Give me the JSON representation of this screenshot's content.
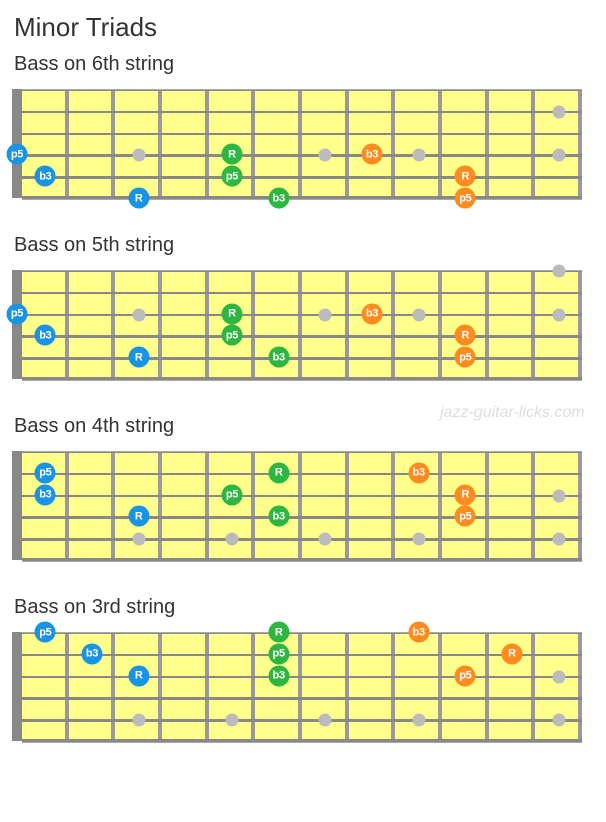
{
  "title": "Minor Triads",
  "watermark": "jazz-guitar-licks.com",
  "fret_count": 12,
  "string_count": 6,
  "fret_markers_single": [
    3,
    5,
    7,
    9
  ],
  "fret_markers_double": [
    12
  ],
  "colors": {
    "blue": "#1893E6",
    "green": "#2DB742",
    "orange": "#FF8A1E"
  },
  "diagrams": [
    {
      "subtitle": "Bass   on 6th string",
      "marker_string": 4,
      "notes": [
        {
          "fret": 0,
          "string": 4,
          "label": "p5",
          "color": "blue"
        },
        {
          "fret": 1,
          "string": 5,
          "label": "b3",
          "color": "blue"
        },
        {
          "fret": 3,
          "string": 6,
          "label": "R",
          "color": "blue"
        },
        {
          "fret": 5,
          "string": 4,
          "label": "R",
          "color": "green"
        },
        {
          "fret": 5,
          "string": 5,
          "label": "p5",
          "color": "green"
        },
        {
          "fret": 6,
          "string": 6,
          "label": "b3",
          "color": "green"
        },
        {
          "fret": 8,
          "string": 4,
          "label": "b3",
          "color": "orange"
        },
        {
          "fret": 10,
          "string": 5,
          "label": "R",
          "color": "orange"
        },
        {
          "fret": 10,
          "string": 6,
          "label": "p5",
          "color": "orange"
        }
      ]
    },
    {
      "subtitle": "Bass   on 5th string",
      "marker_string": 3,
      "notes": [
        {
          "fret": 0,
          "string": 3,
          "label": "p5",
          "color": "blue"
        },
        {
          "fret": 1,
          "string": 4,
          "label": "b3",
          "color": "blue"
        },
        {
          "fret": 3,
          "string": 5,
          "label": "R",
          "color": "blue"
        },
        {
          "fret": 5,
          "string": 3,
          "label": "R",
          "color": "green"
        },
        {
          "fret": 5,
          "string": 4,
          "label": "p5",
          "color": "green"
        },
        {
          "fret": 6,
          "string": 5,
          "label": "b3",
          "color": "green"
        },
        {
          "fret": 8,
          "string": 3,
          "label": "b3",
          "color": "orange"
        },
        {
          "fret": 10,
          "string": 4,
          "label": "R",
          "color": "orange"
        },
        {
          "fret": 10,
          "string": 5,
          "label": "p5",
          "color": "orange"
        }
      ]
    },
    {
      "subtitle": "Bass   on 4th string",
      "marker_string": 5,
      "notes": [
        {
          "fret": 1,
          "string": 2,
          "label": "p5",
          "color": "blue"
        },
        {
          "fret": 1,
          "string": 3,
          "label": "b3",
          "color": "blue"
        },
        {
          "fret": 3,
          "string": 4,
          "label": "R",
          "color": "blue"
        },
        {
          "fret": 6,
          "string": 2,
          "label": "R",
          "color": "green"
        },
        {
          "fret": 5,
          "string": 3,
          "label": "p5",
          "color": "green"
        },
        {
          "fret": 6,
          "string": 4,
          "label": "b3",
          "color": "green"
        },
        {
          "fret": 9,
          "string": 2,
          "label": "b3",
          "color": "orange"
        },
        {
          "fret": 10,
          "string": 3,
          "label": "R",
          "color": "orange"
        },
        {
          "fret": 10,
          "string": 4,
          "label": "p5",
          "color": "orange"
        }
      ]
    },
    {
      "subtitle": "Bass   on 3rd string",
      "marker_string": 5,
      "notes": [
        {
          "fret": 1,
          "string": 1,
          "label": "p5",
          "color": "blue"
        },
        {
          "fret": 2,
          "string": 2,
          "label": "b3",
          "color": "blue"
        },
        {
          "fret": 3,
          "string": 3,
          "label": "R",
          "color": "blue"
        },
        {
          "fret": 6,
          "string": 1,
          "label": "R",
          "color": "green"
        },
        {
          "fret": 6,
          "string": 2,
          "label": "p5",
          "color": "green"
        },
        {
          "fret": 6,
          "string": 3,
          "label": "b3",
          "color": "green"
        },
        {
          "fret": 9,
          "string": 1,
          "label": "b3",
          "color": "orange"
        },
        {
          "fret": 11,
          "string": 2,
          "label": "R",
          "color": "orange"
        },
        {
          "fret": 10,
          "string": 3,
          "label": "p5",
          "color": "orange"
        }
      ]
    }
  ]
}
